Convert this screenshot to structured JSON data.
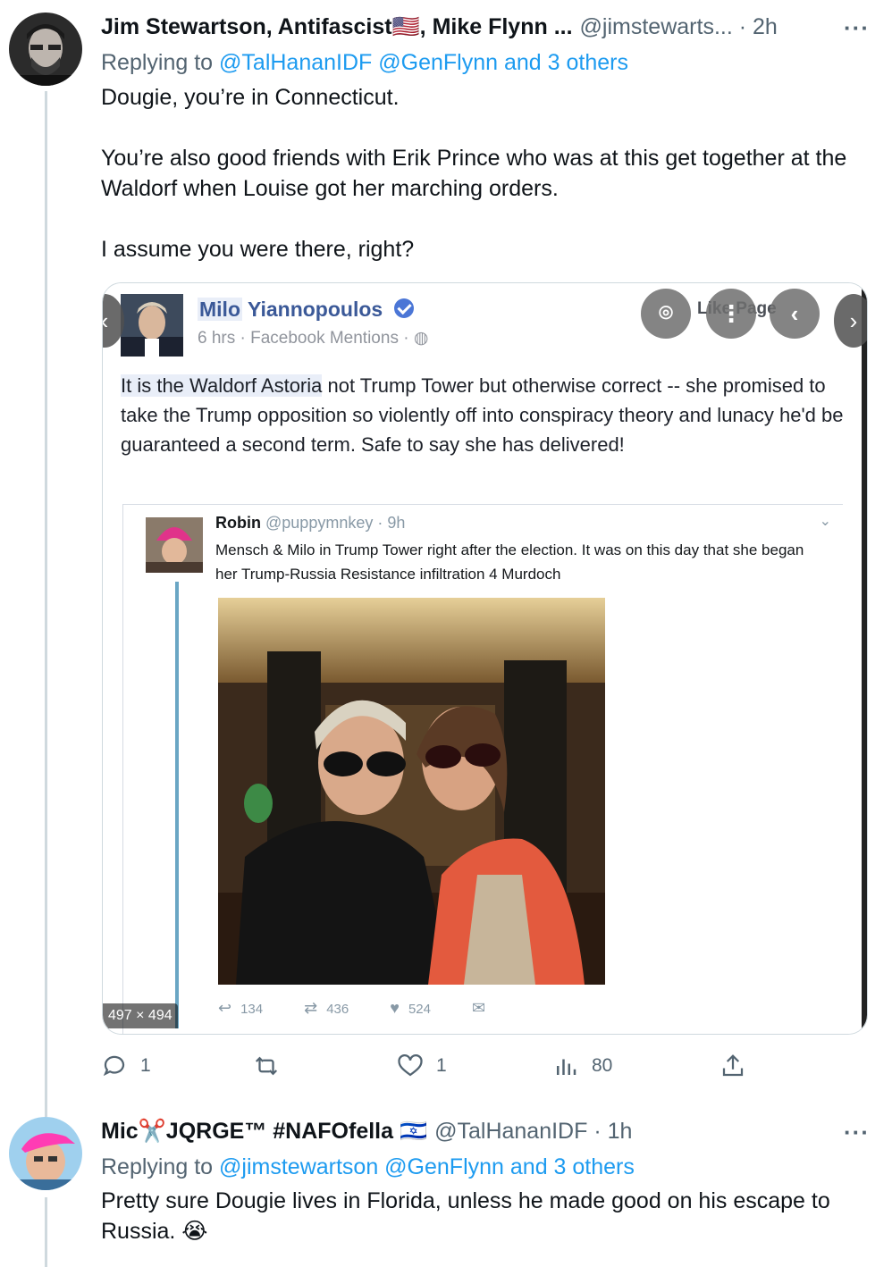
{
  "tweets": [
    {
      "name": "Jim Stewartson, Antifascist🇺🇸, Mike Flynn ...",
      "handle_time": "@jimstewarts... · 2h",
      "replying_prefix": "Replying to",
      "replying_mentions": "@TalHananIDF @GenFlynn and 3 others",
      "paragraphs": [
        "Dougie, you’re in Connecticut.",
        "You’re also good friends with Erik Prince who was at this get together at the Waldorf when Louise got her marching orders.",
        "I assume you were there, right?"
      ],
      "more": "···"
    },
    {
      "name": "Mic✂️JQRGE™ #NAFOfella 🇮🇱",
      "handle_time": "@TalHananIDF · 1h",
      "replying_prefix": "Replying to",
      "replying_mentions": "@jimstewartson @GenFlynn and 3 others",
      "paragraphs": [
        "Pretty sure Dougie lives in Florida, unless he made good on his escape to Russia. 😭"
      ],
      "more": "···"
    }
  ],
  "media": {
    "dims": "497 × 494",
    "overlay_like_page": "Like Page",
    "fb": {
      "name_first": "Milo",
      "name_last": "Yiannopoulos",
      "meta": "6 hrs · Facebook Mentions · ◍",
      "post_hl": "It is the Waldorf Astoria",
      "post_rest": " not Trump Tower but otherwise correct -- she promised to take the Trump opposition so violently off into conspiracy theory and lunacy he'd be guaranteed a second term. Safe to say she has delivered!",
      "robin_name": "Robin",
      "robin_sub": "@puppymnkey · 9h",
      "robin_text": "Mensch & Milo in Trump Tower right after the election. It was on this day that she began her Trump-Russia Resistance infiltration 4 Murdoch",
      "reply_count": "134",
      "retweet_count": "436",
      "like_count": "524"
    }
  },
  "actions": {
    "replies": "1",
    "likes": "1",
    "views": "80"
  }
}
